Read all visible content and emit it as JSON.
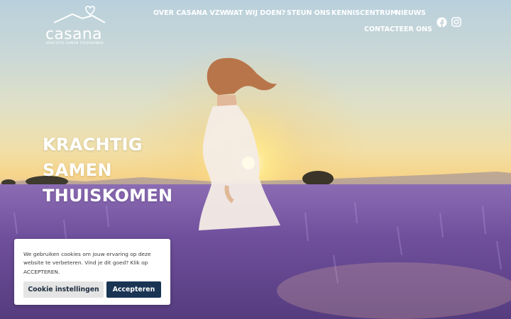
{
  "brand": {
    "name": "casana",
    "tagline": "KRACHTIG SAMEN THUISKOMEN"
  },
  "nav": {
    "items": [
      {
        "label": "OVER CASANA VZW"
      },
      {
        "label": "WAT WIJ DOEN?"
      },
      {
        "label": "STEUN ONS"
      },
      {
        "label": "KENNISCENTRUM"
      },
      {
        "label": "NIEUWS"
      },
      {
        "label": "CONTACTEER ONS"
      }
    ]
  },
  "social": {
    "icons": [
      "facebook-icon",
      "instagram-icon"
    ]
  },
  "hero": {
    "headline": [
      "KRACHTIG",
      "SAMEN",
      "THUISKOMEN"
    ]
  },
  "cookie_banner": {
    "text": "We gebruiken cookies om jouw ervaring op deze website te verbeteren. Vind je dit goed? Klik op ACCEPTEREN.",
    "settings_label": "Cookie instellingen",
    "accept_label": "Accepteren"
  },
  "colors": {
    "accent_dark": "#1a3454",
    "button_light": "#e4e4e4",
    "lavender": "#7d5fa8"
  }
}
